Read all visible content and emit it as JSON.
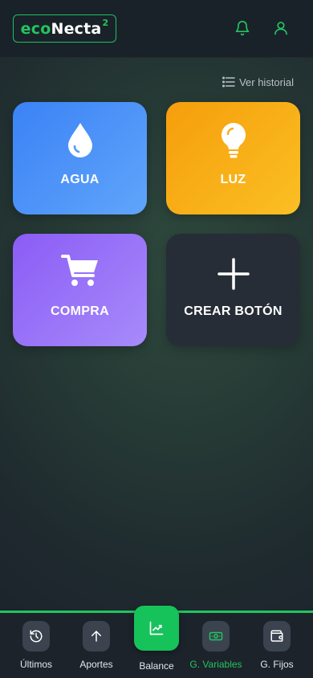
{
  "brand": {
    "part1": "eco",
    "part2": "Necta",
    "sup": "2"
  },
  "header": {
    "icons": [
      "bell-icon",
      "user-icon"
    ]
  },
  "history": {
    "label": "Ver historial",
    "icon": "list-icon"
  },
  "cards": [
    {
      "label": "AGUA",
      "icon": "water-drop-icon",
      "color": "#3b82f6"
    },
    {
      "label": "LUZ",
      "icon": "lightbulb-icon",
      "color": "#f59e0b"
    },
    {
      "label": "COMPRA",
      "icon": "cart-icon",
      "color": "#8b5cf6"
    },
    {
      "label": "CREAR BOTÓN",
      "icon": "plus-icon",
      "color": "#262d37"
    }
  ],
  "nav": {
    "items": [
      {
        "label": "Últimos",
        "icon": "history-icon"
      },
      {
        "label": "Aportes",
        "icon": "arrow-up-icon"
      },
      {
        "label": "Balance",
        "icon": "chart-icon"
      },
      {
        "label": "G. Variables",
        "icon": "cash-icon",
        "active": true
      },
      {
        "label": "G. Fijos",
        "icon": "wallet-icon"
      }
    ],
    "accent": "#22c55e"
  }
}
